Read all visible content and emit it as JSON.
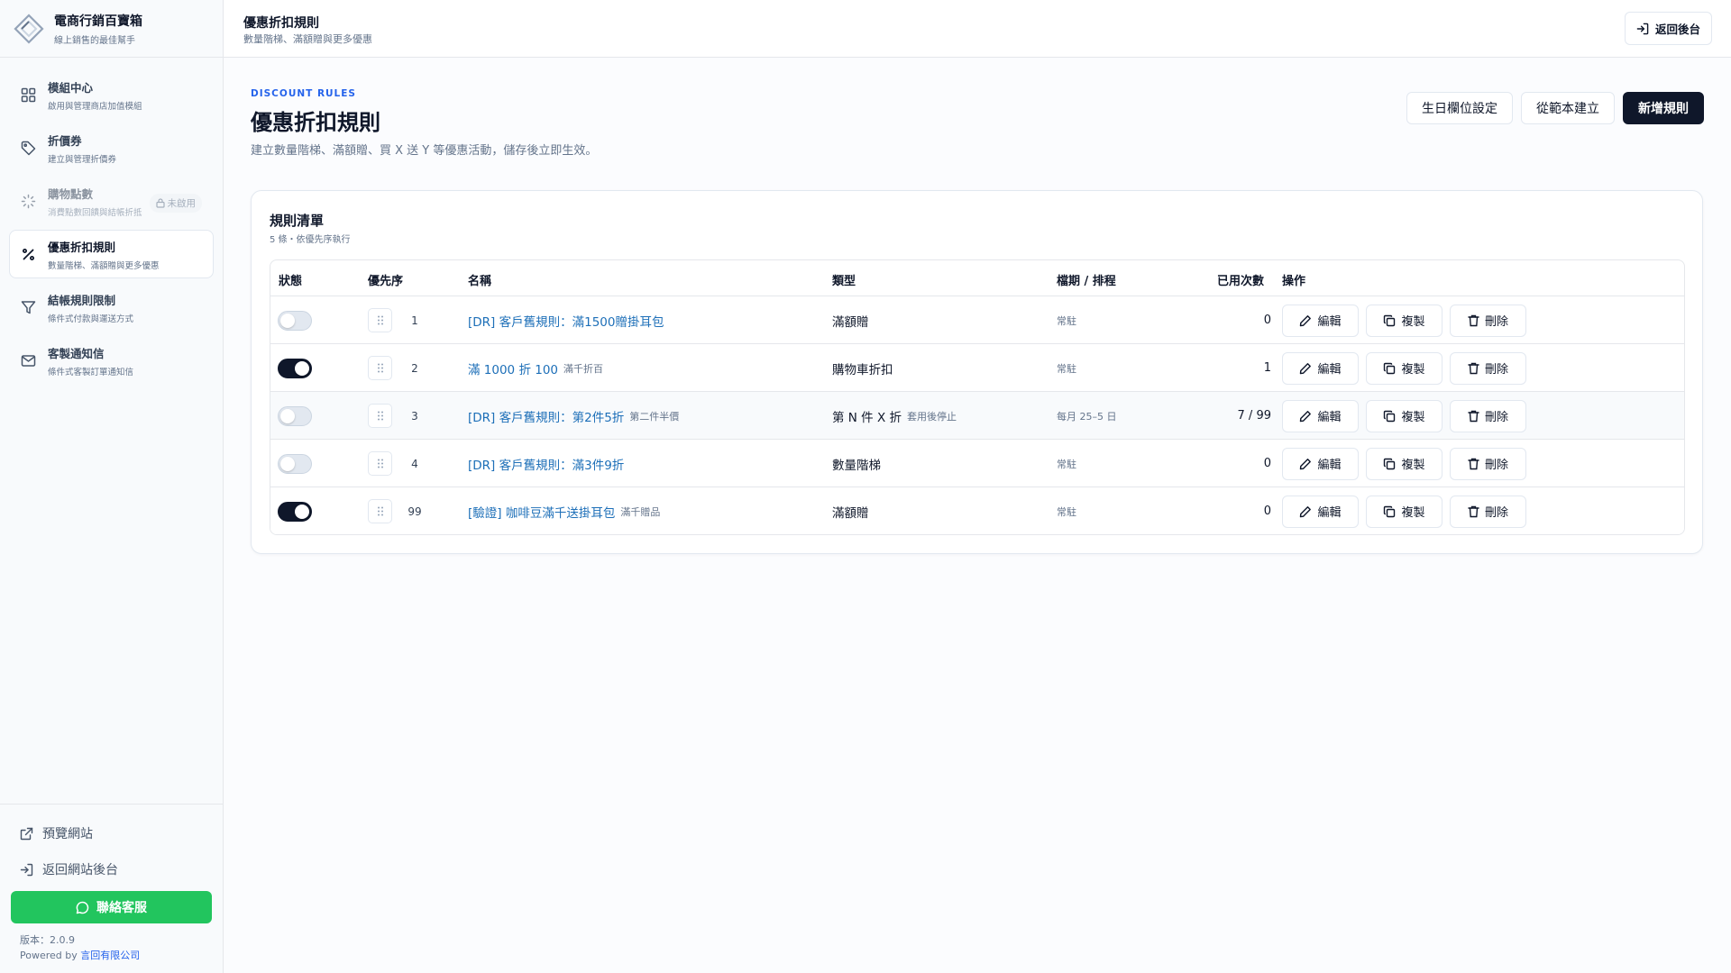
{
  "brand": {
    "title": "電商行銷百寶箱",
    "subtitle": "線上銷售的最佳幫手"
  },
  "sidebar": {
    "items": [
      {
        "label": "模組中心",
        "sub": "啟用與管理商店加值模組",
        "icon": "grid-icon",
        "state": "normal"
      },
      {
        "label": "折價券",
        "sub": "建立與管理折價券",
        "icon": "tag-icon",
        "state": "normal"
      },
      {
        "label": "購物點數",
        "sub": "消費點數回饋與結帳折抵",
        "icon": "loader-icon",
        "state": "disabled",
        "badge": "未啟用"
      },
      {
        "label": "優惠折扣規則",
        "sub": "數量階梯、滿額贈與更多優惠",
        "icon": "percent-icon",
        "state": "active"
      },
      {
        "label": "結帳規則限制",
        "sub": "條件式付款與運送方式",
        "icon": "filter-icon",
        "state": "normal"
      },
      {
        "label": "客製通知信",
        "sub": "條件式客製訂單通知信",
        "icon": "mail-icon",
        "state": "normal"
      }
    ],
    "bottom": {
      "preview": "預覽網站",
      "back_site": "返回網站後台",
      "contact": "聯絡客服",
      "version": "版本：2.0.9",
      "powered_prefix": "Powered by ",
      "powered_company": "言回有限公司"
    }
  },
  "topbar": {
    "title": "優惠折扣規則",
    "subtitle": "數量階梯、滿額贈與更多優惠",
    "back_button": "返回後台"
  },
  "page": {
    "eyebrow": "DISCOUNT RULES",
    "title": "優惠折扣規則",
    "description": "建立數量階梯、滿額贈、買 X 送 Y 等優惠活動，儲存後立即生效。",
    "actions": {
      "birthday": "生日欄位設定",
      "template": "從範本建立",
      "new_rule": "新增規則"
    }
  },
  "rules": {
    "title": "規則清單",
    "subtitle": "5 條・依優先序執行",
    "columns": [
      "狀態",
      "優先序",
      "名稱",
      "類型",
      "檔期 / 排程",
      "已用次數",
      "操作"
    ],
    "row_actions": {
      "edit": "編輯",
      "copy": "複製",
      "delete": "刪除"
    },
    "rows": [
      {
        "enabled": false,
        "priority": "1",
        "name": "[DR] 客戶舊規則：滿1500贈掛耳包",
        "note": "",
        "type": "滿額贈",
        "type_note": "",
        "schedule": "常駐",
        "used": "0"
      },
      {
        "enabled": true,
        "priority": "2",
        "name": "滿 1000 折 100",
        "note": "滿千折百",
        "type": "購物車折扣",
        "type_note": "",
        "schedule": "常駐",
        "used": "1"
      },
      {
        "enabled": false,
        "priority": "3",
        "name": "[DR] 客戶舊規則：第2件5折",
        "note": "第二件半價",
        "type": "第 N 件 X 折",
        "type_note": "套用後停止",
        "schedule": "每月 25–5 日",
        "used": "7 / 99"
      },
      {
        "enabled": false,
        "priority": "4",
        "name": "[DR] 客戶舊規則：滿3件9折",
        "note": "",
        "type": "數量階梯",
        "type_note": "",
        "schedule": "常駐",
        "used": "0"
      },
      {
        "enabled": true,
        "priority": "99",
        "name": "[驗證] 咖啡豆滿千送掛耳包",
        "note": "滿千贈品",
        "type": "滿額贈",
        "type_note": "",
        "schedule": "常駐",
        "used": "0"
      }
    ]
  },
  "colors": {
    "accent": "#0f172a",
    "link": "#1d6fb8",
    "eyebrow": "#2563eb",
    "contact": "#22c55e"
  }
}
